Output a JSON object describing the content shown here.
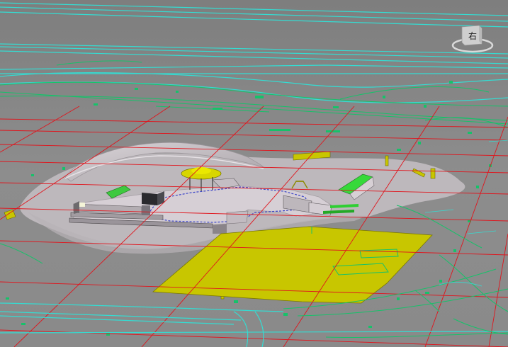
{
  "viewport": {
    "background_color": "#8c8c8c",
    "grid_color": "#e0151d",
    "cad_line_color": "#34dcd2",
    "cad_green_color": "#16c26a",
    "pad_yellow_color": "#c8c600",
    "terrain_color": "#c6bfc4"
  },
  "viewcube": {
    "face_label": "右",
    "icon": "view-cube-icon"
  }
}
